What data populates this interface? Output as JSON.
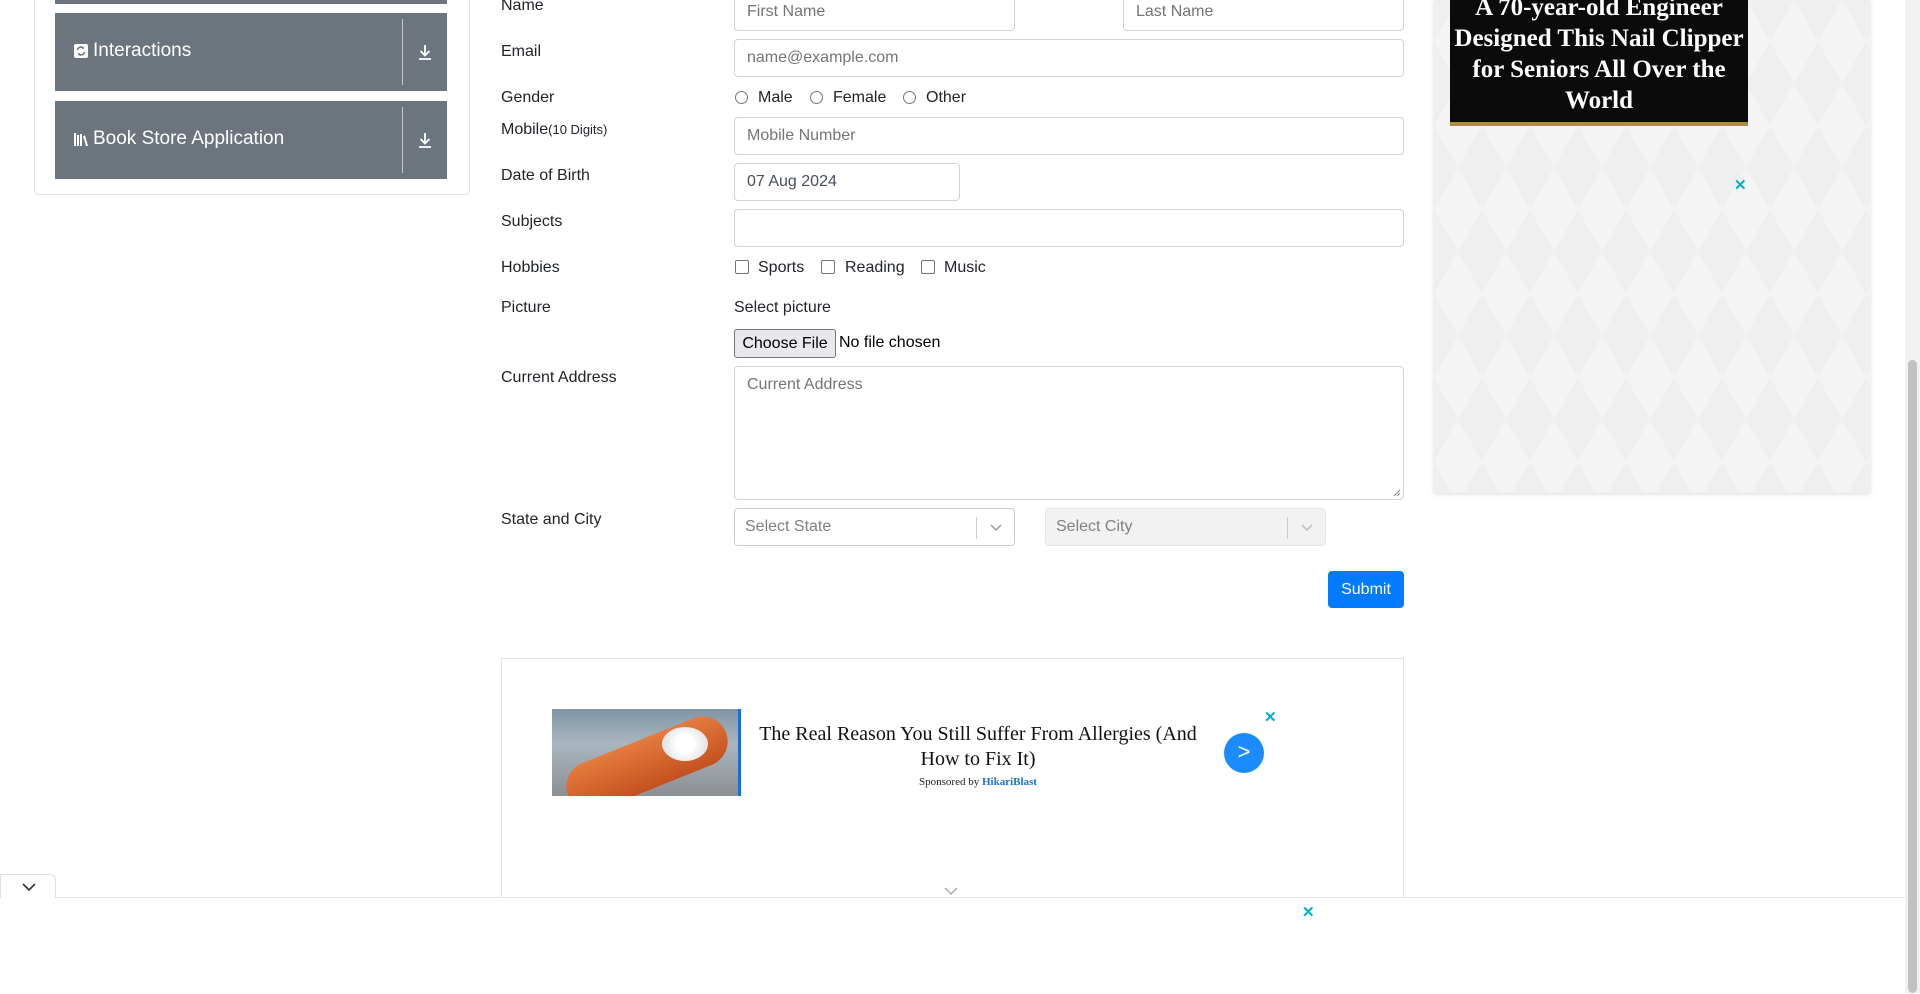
{
  "sidebar": {
    "items": [
      {
        "label": "Interactions",
        "icon": "interactions-icon"
      },
      {
        "label": "Book Store Application",
        "icon": "books-icon"
      }
    ]
  },
  "form": {
    "name_label": "Name",
    "first_name_placeholder": "First Name",
    "last_name_placeholder": "Last Name",
    "email_label": "Email",
    "email_placeholder": "name@example.com",
    "gender_label": "Gender",
    "gender_options": [
      "Male",
      "Female",
      "Other"
    ],
    "mobile_label": "Mobile",
    "mobile_hint": "(10 Digits)",
    "mobile_placeholder": "Mobile Number",
    "dob_label": "Date of Birth",
    "dob_value": "07 Aug 2024",
    "subjects_label": "Subjects",
    "hobbies_label": "Hobbies",
    "hobby_options": [
      "Sports",
      "Reading",
      "Music"
    ],
    "picture_label": "Picture",
    "select_picture_label": "Select picture",
    "choose_file_label": "Choose File",
    "no_file_text": "No file chosen",
    "address_label": "Current Address",
    "address_placeholder": "Current Address",
    "state_city_label": "State and City",
    "state_placeholder": "Select State",
    "city_placeholder": "Select City",
    "submit_label": "Submit"
  },
  "ads": {
    "right_headline": "A 70-year-old Engineer Designed This Nail Clipper for Seniors All Over the World",
    "close_glyph": "✕",
    "bottom_title": "The Real Reason You Still Suffer From Allergies (And How to Fix It)",
    "bottom_sponsor_prefix": "Sponsored by",
    "bottom_sponsor": "HikariBlast",
    "bottom_go": ">"
  },
  "colors": {
    "sidebar_item_bg": "#6c757d",
    "primary": "#007bff",
    "ad_close": "#00aecd"
  }
}
